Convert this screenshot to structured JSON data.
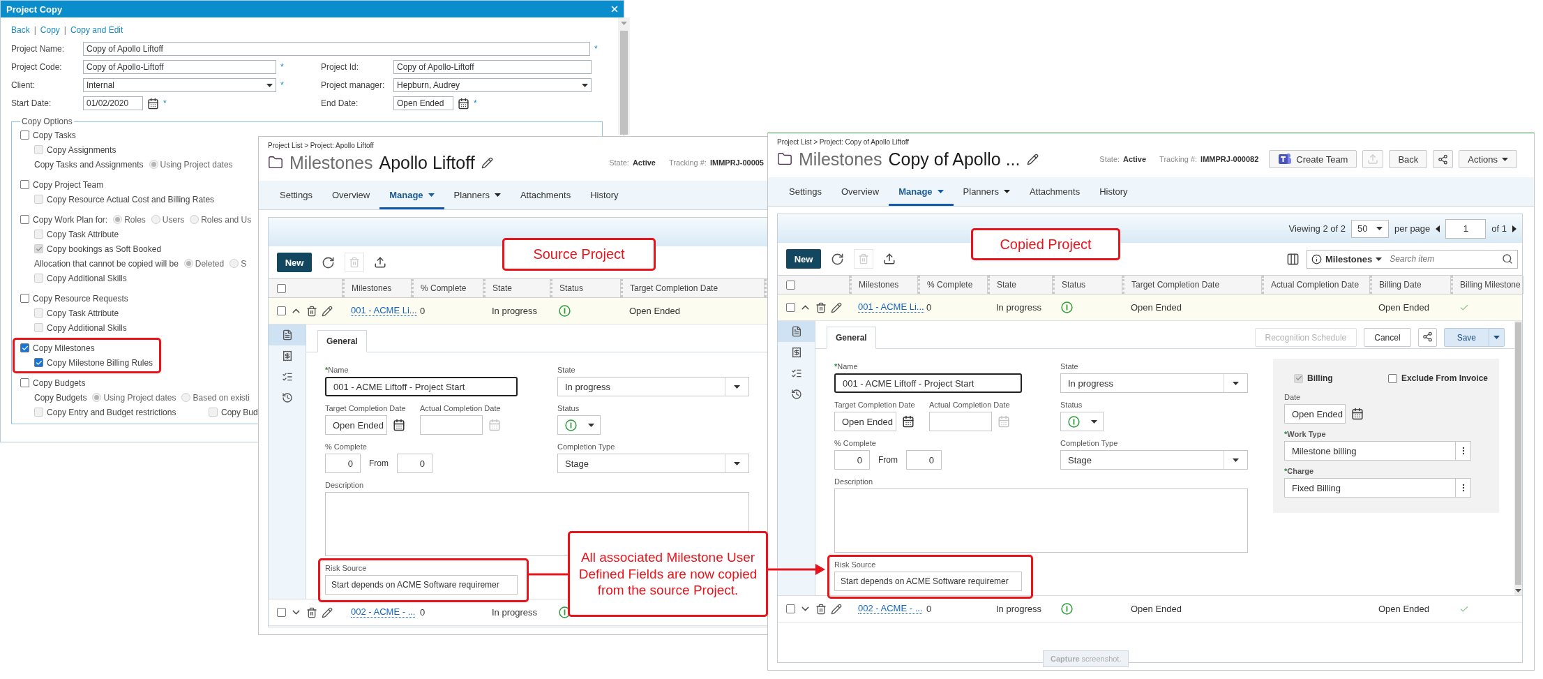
{
  "dialog": {
    "title": "Project Copy",
    "links": [
      "Back",
      "Copy",
      "Copy and Edit"
    ],
    "separators": [
      "|",
      "|"
    ],
    "field_rows": [
      [
        {
          "label": "Project Name:",
          "kind": "text",
          "value": "Copy of Apollo Liftoff",
          "required_mark": "*"
        }
      ],
      [
        {
          "label": "Project Code:",
          "kind": "text",
          "value": "Copy of Apollo-Liftoff",
          "required_mark": "*"
        },
        {
          "label": "Project Id:",
          "kind": "text",
          "value": "Copy of Apollo-Liftoff"
        }
      ],
      [
        {
          "label": "Client:",
          "kind": "select",
          "value": "Internal",
          "required_mark": "*"
        },
        {
          "label": "Project manager:",
          "kind": "select",
          "value": "Hepburn, Audrey"
        }
      ],
      [
        {
          "label": "Start Date:",
          "kind": "date",
          "value": "01/02/2020",
          "required_mark": "*"
        },
        {
          "label": "End Date:",
          "kind": "date",
          "value": "Open Ended",
          "required_mark": "*"
        }
      ]
    ],
    "copy_options": {
      "legend": "Copy Options",
      "items": [
        {
          "kind": "checkbox",
          "label": "Copy Tasks",
          "checked": false,
          "disabled": false,
          "children": [
            {
              "kind": "checkbox",
              "label": "Copy Assignments",
              "checked": false,
              "disabled": true
            },
            {
              "kind": "radio_group",
              "label": "Copy Tasks and Assignments",
              "options": [
                {
                  "label": "Using Project dates",
                  "selected": true,
                  "disabled": true
                }
              ]
            }
          ]
        },
        {
          "kind": "checkbox",
          "label": "Copy Project Team",
          "checked": false,
          "disabled": false,
          "children": [
            {
              "kind": "checkbox",
              "label": "Copy Resource Actual Cost and Billing Rates",
              "checked": false,
              "disabled": true
            }
          ]
        },
        {
          "kind": "checkbox",
          "label": "Copy Work Plan for:",
          "checked": false,
          "disabled": false,
          "options": [
            {
              "label": "Roles",
              "selected": true,
              "disabled": true
            },
            {
              "label": "Users",
              "selected": false,
              "disabled": true
            },
            {
              "label": "Roles and Us",
              "selected": false,
              "disabled": true
            }
          ],
          "children": [
            {
              "kind": "checkbox",
              "label": "Copy Task Attribute",
              "checked": false,
              "disabled": true
            },
            {
              "kind": "checkbox",
              "label": "Copy bookings as Soft Booked",
              "checked": true,
              "disabled": true
            },
            {
              "kind": "radio_group",
              "label": "Allocation that cannot be copied will be",
              "options": [
                {
                  "label": "Deleted",
                  "selected": true,
                  "disabled": true
                },
                {
                  "label": "S",
                  "selected": false,
                  "disabled": true
                }
              ]
            },
            {
              "kind": "checkbox",
              "label": "Copy Additional Skills",
              "checked": false,
              "disabled": true
            }
          ]
        },
        {
          "kind": "checkbox",
          "label": "Copy Resource Requests",
          "checked": false,
          "disabled": false,
          "children": [
            {
              "kind": "checkbox",
              "label": "Copy Task Attribute",
              "checked": false,
              "disabled": true
            },
            {
              "kind": "checkbox",
              "label": "Copy Additional Skills",
              "checked": false,
              "disabled": true
            }
          ]
        },
        {
          "kind": "checkbox",
          "label": "Copy Milestones",
          "checked": true,
          "disabled": false,
          "highlighted": true,
          "children": [
            {
              "kind": "checkbox",
              "label": "Copy Milestone Billing Rules",
              "checked": true,
              "disabled": false
            }
          ]
        },
        {
          "kind": "checkbox",
          "label": "Copy Budgets",
          "checked": false,
          "disabled": false,
          "children": [
            {
              "kind": "radio_group",
              "label": "Copy Budgets",
              "options": [
                {
                  "label": "Using Project dates",
                  "selected": true,
                  "disabled": true
                },
                {
                  "label": "Based on existi",
                  "selected": false,
                  "disabled": true
                }
              ]
            },
            {
              "kind": "checkbox_row",
              "items": [
                {
                  "kind": "checkbox",
                  "label": "Copy Entry and Budget restrictions",
                  "checked": false,
                  "disabled": true
                },
                {
                  "kind": "checkbox",
                  "label": "Copy Bud",
                  "checked": false,
                  "disabled": true
                }
              ]
            }
          ]
        }
      ]
    }
  },
  "source_project": {
    "breadcrumb": "Project List > Project: Apollo Liftoff",
    "section": "Milestones",
    "title": "Apollo Liftoff",
    "state_label": "State:",
    "state_value": "Active",
    "tracking_label": "Tracking #:",
    "tracking_value": "IMMPRJ-00005",
    "tabs": [
      {
        "label": "Settings",
        "selected": false,
        "menu": false
      },
      {
        "label": "Overview",
        "selected": false,
        "menu": false
      },
      {
        "label": "Manage",
        "selected": true,
        "menu": true
      },
      {
        "label": "Planners",
        "selected": false,
        "menu": true
      },
      {
        "label": "Attachments",
        "selected": false,
        "menu": false
      },
      {
        "label": "History",
        "selected": false,
        "menu": false
      }
    ],
    "toolbar": {
      "new_label": "New",
      "delete_disabled": true
    },
    "select_all_checked": false,
    "columns": [
      "Milestones",
      "% Complete",
      "State",
      "Status",
      "Target Completion Date"
    ],
    "rows": [
      {
        "expanded": true,
        "checked": false,
        "cells": [
          {
            "kind": "link",
            "text": "001 - ACME Li..."
          },
          {
            "kind": "text",
            "text": "0"
          },
          {
            "kind": "text",
            "text": "In progress"
          },
          {
            "kind": "status"
          },
          {
            "kind": "text",
            "text": "Open Ended"
          }
        ]
      },
      {
        "expanded": false,
        "checked": false,
        "cells": [
          {
            "kind": "link",
            "text": "002 - ACME - ..."
          },
          {
            "kind": "text",
            "text": "0"
          },
          {
            "kind": "text",
            "text": "In progress"
          },
          {
            "kind": "status"
          }
        ]
      }
    ],
    "detail": {
      "side_tabs": [
        {
          "selected": true
        },
        {
          "selected": false
        },
        {
          "selected": false
        },
        {
          "selected": false
        }
      ],
      "tabs": [
        {
          "label": "General",
          "selected": true
        }
      ],
      "name": {
        "label": "Name",
        "required_mark": "*",
        "value": "001 - ACME Liftoff - Project Start",
        "focused": true
      },
      "state": {
        "label": "State",
        "value": "In progress"
      },
      "target_date": {
        "label": "Target Completion Date",
        "value": "Open Ended"
      },
      "actual_date": {
        "label": "Actual Completion Date"
      },
      "status": {
        "label": "Status"
      },
      "percent": {
        "label": "% Complete",
        "value": "0",
        "from_label": "From",
        "from_value": "0"
      },
      "completion_type": {
        "label": "Completion Type",
        "value": "Stage"
      },
      "description": {
        "label": "Description"
      },
      "risk_source": {
        "label": "Risk Source",
        "value": "Start depends on ACME Software requiremer",
        "highlighted": true
      }
    }
  },
  "copied_project": {
    "breadcrumb": "Project List > Project: Copy of Apollo Liftoff",
    "section": "Milestones",
    "title": "Copy of Apollo ...",
    "state_label": "State:",
    "state_value": "Active",
    "tracking_label": "Tracking #:",
    "tracking_value": "IMMPRJ-000082",
    "header_buttons": [
      {
        "kind": "teams",
        "label": "Create Team"
      },
      {
        "kind": "export",
        "disabled": true
      },
      {
        "kind": "button",
        "label": "Back"
      },
      {
        "kind": "share"
      },
      {
        "kind": "menu",
        "label": "Actions"
      }
    ],
    "tabs": [
      {
        "label": "Settings",
        "selected": false,
        "menu": false
      },
      {
        "label": "Overview",
        "selected": false,
        "menu": false
      },
      {
        "label": "Manage",
        "selected": true,
        "menu": true
      },
      {
        "label": "Planners",
        "selected": false,
        "menu": true
      },
      {
        "label": "Attachments",
        "selected": false,
        "menu": false
      },
      {
        "label": "History",
        "selected": false,
        "menu": false
      }
    ],
    "pager": {
      "viewing": "Viewing 2 of 2",
      "per_page_value": "50",
      "per_page_label": "per page",
      "page_value": "1",
      "page_total": "of 1"
    },
    "toolbar": {
      "new_label": "New",
      "delete_disabled": true
    },
    "search": {
      "scope": "Milestones",
      "placeholder": "Search item"
    },
    "select_all_checked": false,
    "columns": [
      "Milestones",
      "% Complete",
      "State",
      "Status",
      "Target Completion Date",
      "Actual Completion Date",
      "Billing Date",
      "Billing Milestone"
    ],
    "rows": [
      {
        "expanded": true,
        "checked": false,
        "cells": [
          {
            "kind": "link",
            "text": "001 - ACME Li..."
          },
          {
            "kind": "text",
            "text": "0"
          },
          {
            "kind": "text",
            "text": "In progress"
          },
          {
            "kind": "status"
          },
          {
            "kind": "text",
            "text": "Open Ended"
          },
          {
            "kind": "blank"
          },
          {
            "kind": "text",
            "text": "Open Ended"
          },
          {
            "kind": "check",
            "checked": true
          }
        ]
      },
      {
        "expanded": false,
        "checked": false,
        "cells": [
          {
            "kind": "link",
            "text": "002 - ACME - ..."
          },
          {
            "kind": "text",
            "text": "0"
          },
          {
            "kind": "text",
            "text": "In progress"
          },
          {
            "kind": "status"
          },
          {
            "kind": "text",
            "text": "Open Ended"
          },
          {
            "kind": "blank"
          },
          {
            "kind": "text",
            "text": "Open Ended"
          },
          {
            "kind": "check",
            "checked": true
          }
        ]
      }
    ],
    "detail": {
      "side_tabs": [
        {
          "selected": true
        },
        {
          "selected": false
        },
        {
          "selected": false
        },
        {
          "selected": false
        }
      ],
      "tabs": [
        {
          "label": "General",
          "selected": true
        }
      ],
      "actions": [
        {
          "kind": "button",
          "label": "Recognition Schedule",
          "disabled": true
        },
        {
          "kind": "button",
          "label": "Cancel",
          "disabled": false
        },
        {
          "kind": "share"
        },
        {
          "kind": "split",
          "label": "Save",
          "disabled": false
        }
      ],
      "name": {
        "label": "Name",
        "required_mark": "*",
        "value": "001 - ACME Liftoff - Project Start",
        "focused": true
      },
      "state": {
        "label": "State",
        "value": "In progress"
      },
      "target_date": {
        "label": "Target Completion Date",
        "value": "Open Ended"
      },
      "actual_date": {
        "label": "Actual Completion Date"
      },
      "status": {
        "label": "Status"
      },
      "percent": {
        "label": "% Complete",
        "value": "0",
        "from_label": "From",
        "from_value": "0"
      },
      "completion_type": {
        "label": "Completion Type",
        "value": "Stage"
      },
      "description": {
        "label": "Description"
      },
      "risk_source": {
        "label": "Risk Source",
        "value": "Start depends on ACME Software requiremer",
        "highlighted": true
      },
      "billing": {
        "billing": {
          "label": "Billing",
          "checked": true,
          "disabled": true
        },
        "exclude": {
          "label": "Exclude From Invoice",
          "checked": false,
          "disabled": false
        },
        "date": {
          "label": "Date",
          "value": "Open Ended"
        },
        "work_type": {
          "label": "Work Type",
          "required_mark": "*",
          "value": "Milestone billing"
        },
        "charge": {
          "label": "Charge",
          "required_mark": "*",
          "value": "Fixed Billing"
        }
      }
    },
    "capture_button": {
      "label": "**Capture** screenshot.",
      "disabled": true
    }
  },
  "annotations": [
    {
      "kind": "label",
      "text": "Source Project"
    },
    {
      "kind": "label",
      "text": "Copied Project"
    },
    {
      "kind": "callout",
      "text": "All associated Milestone User Defined Fields are now copied from the source Project."
    }
  ]
}
